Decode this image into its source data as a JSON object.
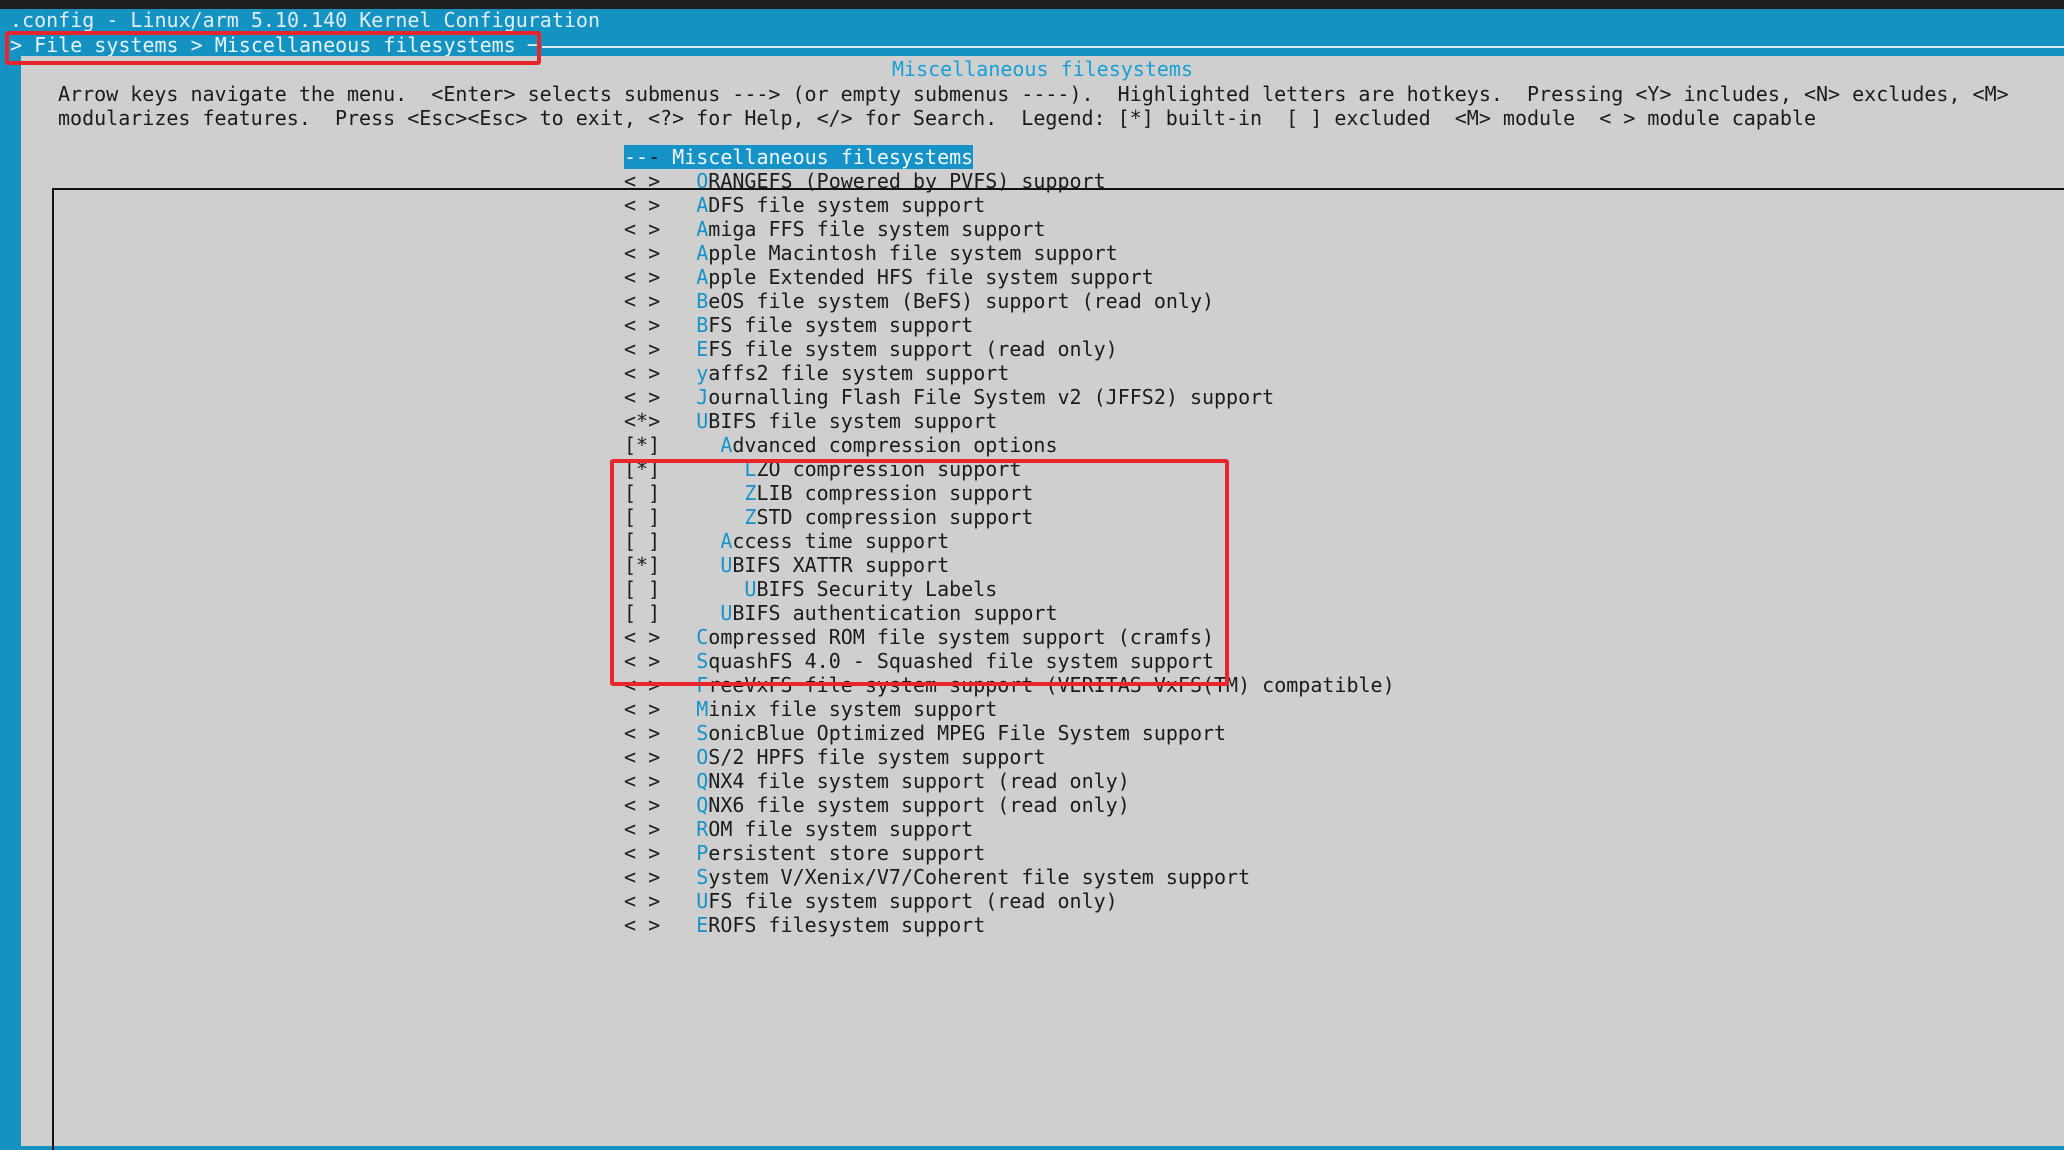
{
  "window": {
    "title": ".config - Linux/arm 5.10.140 Kernel Configuration",
    "breadcrumb": "> File systems > Miscellaneous filesystems ─"
  },
  "dialog": {
    "title": "Miscellaneous filesystems",
    "help_line1": "Arrow keys navigate the menu.  <Enter> selects submenus ---> (or empty submenus ----).  Highlighted letters are hotkeys.  Pressing <Y> includes, <N> excludes, <M>",
    "help_line2": "modularizes features.  Press <Esc><Esc> to exit, <?> for Help, </> for Search.  Legend: [*] built-in  [ ] excluded  <M> module  < > module capable"
  },
  "colors": {
    "terminal_bg": "#1492c2",
    "dialog_bg": "#cfcfcf",
    "hotkey": "#1593c9",
    "highlight_box": "#e8252b"
  },
  "menu": {
    "selected": {
      "state": "--",
      "hotkey": "-",
      "text": " Miscellaneous filesystems"
    },
    "items": [
      {
        "state": "< >",
        "indent": "   ",
        "hotkey": "O",
        "text": "RANGEFS (Powered by PVFS) support"
      },
      {
        "state": "< >",
        "indent": "   ",
        "hotkey": "A",
        "text": "DFS file system support"
      },
      {
        "state": "< >",
        "indent": "   ",
        "hotkey": "A",
        "text": "miga FFS file system support"
      },
      {
        "state": "< >",
        "indent": "   ",
        "hotkey": "A",
        "text": "pple Macintosh file system support"
      },
      {
        "state": "< >",
        "indent": "   ",
        "hotkey": "A",
        "text": "pple Extended HFS file system support"
      },
      {
        "state": "< >",
        "indent": "   ",
        "hotkey": "B",
        "text": "eOS file system (BeFS) support (read only)"
      },
      {
        "state": "< >",
        "indent": "   ",
        "hotkey": "B",
        "text": "FS file system support"
      },
      {
        "state": "< >",
        "indent": "   ",
        "hotkey": "E",
        "text": "FS file system support (read only)"
      },
      {
        "state": "< >",
        "indent": "   ",
        "hotkey": "y",
        "text": "affs2 file system support"
      },
      {
        "state": "< >",
        "indent": "   ",
        "hotkey": "J",
        "text": "ournalling Flash File System v2 (JFFS2) support"
      },
      {
        "state": "<*>",
        "indent": "   ",
        "hotkey": "U",
        "text": "BIFS file system support"
      },
      {
        "state": "[*]",
        "indent": "     ",
        "hotkey": "A",
        "text": "dvanced compression options"
      },
      {
        "state": "[*]",
        "indent": "       ",
        "hotkey": "L",
        "text": "ZO compression support"
      },
      {
        "state": "[ ]",
        "indent": "       ",
        "hotkey": "Z",
        "text": "LIB compression support"
      },
      {
        "state": "[ ]",
        "indent": "       ",
        "hotkey": "Z",
        "text": "STD compression support"
      },
      {
        "state": "[ ]",
        "indent": "     ",
        "hotkey": "A",
        "text": "ccess time support"
      },
      {
        "state": "[*]",
        "indent": "     ",
        "hotkey": "U",
        "text": "BIFS XATTR support"
      },
      {
        "state": "[ ]",
        "indent": "       ",
        "hotkey": "U",
        "text": "BIFS Security Labels"
      },
      {
        "state": "[ ]",
        "indent": "     ",
        "hotkey": "U",
        "text": "BIFS authentication support"
      },
      {
        "state": "< >",
        "indent": "   ",
        "hotkey": "C",
        "text": "ompressed ROM file system support (cramfs)"
      },
      {
        "state": "< >",
        "indent": "   ",
        "hotkey": "S",
        "text": "quashFS 4.0 - Squashed file system support"
      },
      {
        "state": "< >",
        "indent": "   ",
        "hotkey": "F",
        "text": "reeVxFS file system support (VERITAS VxFS(TM) compatible)"
      },
      {
        "state": "< >",
        "indent": "   ",
        "hotkey": "M",
        "text": "inix file system support",
        "hot_pos": 1
      },
      {
        "state": "< >",
        "indent": "   ",
        "hotkey": "S",
        "text": "onicBlue Optimized MPEG File System support"
      },
      {
        "state": "< >",
        "indent": "   ",
        "hotkey": "O",
        "text": "S/2 HPFS file system support"
      },
      {
        "state": "< >",
        "indent": "   ",
        "hotkey": "Q",
        "text": "NX4 file system support (read only)"
      },
      {
        "state": "< >",
        "indent": "   ",
        "hotkey": "Q",
        "text": "NX6 file system support (read only)"
      },
      {
        "state": "< >",
        "indent": "   ",
        "hotkey": "R",
        "text": "OM file system support"
      },
      {
        "state": "< >",
        "indent": "   ",
        "hotkey": "P",
        "text": "ersistent store support"
      },
      {
        "state": "< >",
        "indent": "   ",
        "hotkey": "S",
        "text": "ystem V/Xenix/V7/Coherent file system support"
      },
      {
        "state": "< >",
        "indent": "   ",
        "hotkey": "U",
        "text": "FS file system support (read only)"
      },
      {
        "state": "< >",
        "indent": "   ",
        "hotkey": "E",
        "text": "ROFS filesystem support"
      }
    ]
  }
}
